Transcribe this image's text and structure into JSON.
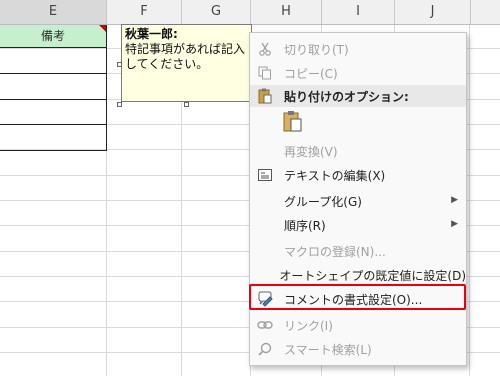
{
  "columns": [
    {
      "id": "E",
      "header_label": "E"
    },
    {
      "id": "F",
      "header_label": "F"
    },
    {
      "id": "G",
      "header_label": "G"
    },
    {
      "id": "H",
      "header_label": "H"
    },
    {
      "id": "I",
      "header_label": "I"
    },
    {
      "id": "J",
      "header_label": "J"
    }
  ],
  "table": {
    "header_text": "備考",
    "header_color": "#c6efce"
  },
  "comment": {
    "author": "秋葉一郎:",
    "line1": "特記事項があれば記入",
    "line2": "してください。"
  },
  "context_menu": {
    "cut": "切り取り(T)",
    "copy": "コピー(C)",
    "paste_options": "貼り付けのオプション:",
    "reconvert": "再変換(V)",
    "edit_text": "テキストの編集(X)",
    "group": "グループ化(G)",
    "order": "順序(R)",
    "assign_macro": "マクロの登録(N)...",
    "set_autoshape_default": "オートシェイプの既定値に設定(D)",
    "format_comment": "コメントの書式設定(O)...",
    "link": "リンク(I)",
    "smart_lookup": "スマート検索(L)"
  },
  "highlight_color": "#e60012",
  "icons": {
    "cut": "scissors-icon",
    "copy": "copy-icon",
    "paste": "clipboard-icon",
    "edit_text": "text-box-icon",
    "format_comment": "format-comment-icon",
    "link": "link-icon",
    "smart_lookup": "search-icon"
  }
}
